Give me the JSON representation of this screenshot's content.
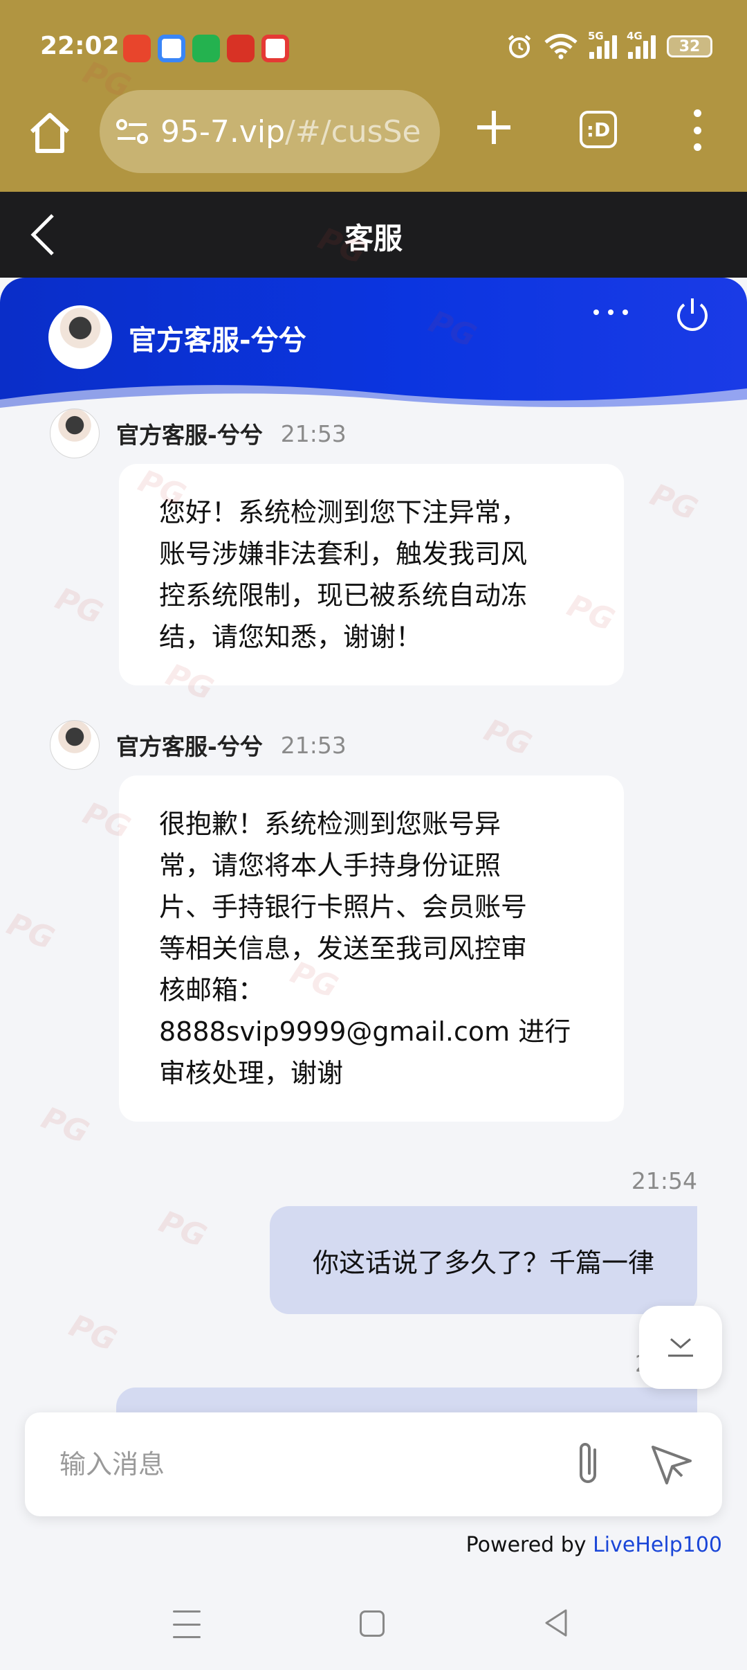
{
  "status_bar": {
    "time": "22:02",
    "network_1": "5G",
    "network_2": "4G",
    "battery": "32",
    "app_icons": [
      "taobao-icon",
      "app-icon-blue",
      "app-icon-green",
      "app-icon-red",
      "map-icon"
    ]
  },
  "browser": {
    "url_visible": "95-7.vip",
    "url_rest": "/#/cusSe",
    "tabs_label": ":D"
  },
  "app": {
    "title": "客服"
  },
  "chat": {
    "agent_name": "官方客服-兮兮",
    "messages": [
      {
        "sender": "官方客服-兮兮",
        "time": "21:53",
        "lines": [
          "您好！系统检测到您下注异常，",
          "账号涉嫌非法套利，触发我司风",
          "控系统限制，现已被系统自动冻",
          "结，请您知悉，谢谢！"
        ]
      },
      {
        "sender": "官方客服-兮兮",
        "time": "21:53",
        "lines": [
          "很抱歉！系统检测到您账号异",
          "常，请您将本人手持身份证照",
          "片、手持银行卡照片、会员账号",
          "等相关信息，发送至我司风控审",
          "核邮箱：",
          "8888svip9999@gmail.com 进行",
          "审核处理，谢谢"
        ]
      }
    ],
    "outgoing": {
      "time": "21:54",
      "text": "你这话说了多久了？千篇一律"
    },
    "partial_time": "2"
  },
  "input": {
    "placeholder": "输入消息"
  },
  "footer": {
    "powered_prefix": "Powered by ",
    "powered_brand": "LiveHelp100"
  },
  "watermark_text": "PG",
  "colors": {
    "browser_bar": "#b19541",
    "chat_header": "#0b35e0",
    "outgoing_bubble": "#d4daf1",
    "brand_link": "#1a46d8"
  }
}
